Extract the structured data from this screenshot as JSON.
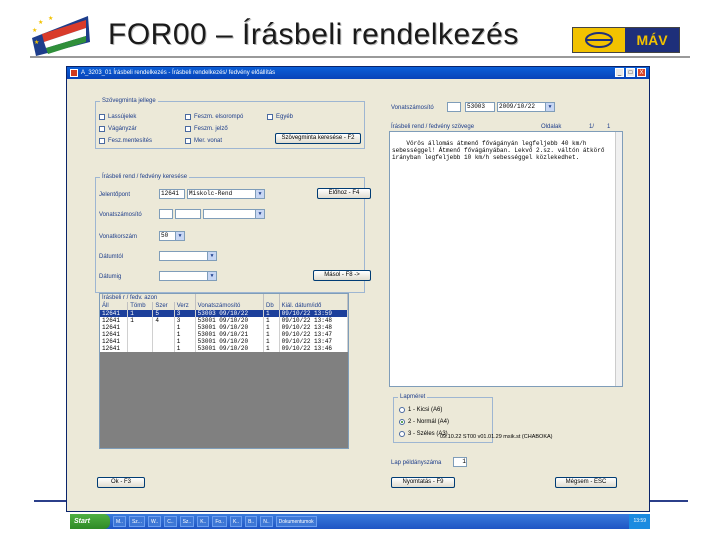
{
  "slide": {
    "title": "FOR00 – Írásbeli rendelkezés",
    "mav_logo_text": "MÁV"
  },
  "window": {
    "title": "A_3203_01  Írásbeli rendelkezés - Írásbeli rendelkezés/ fedvény előállítás",
    "buttons": [
      "_",
      "□",
      "X"
    ]
  },
  "doc_type": {
    "group_title": "Szövegminta jellege",
    "options": [
      "Lassújelek",
      "Vágányzár",
      "Fesz.mentesítés",
      "Feszm. elsorompó",
      "Feszm. jelző",
      "Mer. vonat",
      "Egyéb"
    ],
    "button": "Szövegminta keresése - F2"
  },
  "train": {
    "label": "Vonatszámosító",
    "number": "53003",
    "date": "2009/10/22"
  },
  "text_section": {
    "label": "Írásbeli rend / fedvény szövege",
    "pages_label": "Oldalak",
    "page": "1/",
    "total": "1",
    "body": "Vörös állomás átmenő fővágányán legfeljebb 40 km/h sebességgel! Átmenő fővágányában. Lekvő 2.sz. váltón átkörő irányban legfeljebb 10 km/h sebességgel közlekedhet."
  },
  "search": {
    "group_title": "Írásbeli rend / fedvény keresése",
    "location_label": "Jelentőpont",
    "location_code": "12641",
    "location_name": "Miskolc-Rend",
    "train_label": "Vonatszámosító",
    "hours_label": "Vonatkorszám",
    "hours_value": "50",
    "from_label": "Dátumtól",
    "to_label": "Dátumig",
    "fetch_button": "Előhoz - F4",
    "copy_button": "Másol - F8 ->"
  },
  "grid": {
    "title": "Írásbeli r / fedv. azon",
    "columns": [
      "Áll",
      "Tömb",
      "Szer",
      "Verz",
      "Vonatszámosító",
      "Db",
      "Kiál. dátum/idő"
    ],
    "rows": [
      [
        "12641",
        "1",
        "5",
        "3",
        "53003 09/10/22",
        "1",
        "09/10/22 13:59"
      ],
      [
        "12641",
        "1",
        "4",
        "3",
        "53001 09/10/20",
        "1",
        "09/10/22 13:48"
      ],
      [
        "12641",
        "",
        "",
        "1",
        "53001 09/10/20",
        "1",
        "09/10/22 13:48"
      ],
      [
        "12641",
        "",
        "",
        "1",
        "53001 09/10/21",
        "1",
        "09/10/22 13:47"
      ],
      [
        "12641",
        "",
        "",
        "1",
        "53001 09/10/20",
        "1",
        "09/10/22 13:47"
      ],
      [
        "12641",
        "",
        "",
        "1",
        "53001 09/10/20",
        "1",
        "09/10/22 13:46"
      ]
    ]
  },
  "paper": {
    "group_title": "Lapméret",
    "options": [
      "1 - Kicsi (A6)",
      "2 - Normál (A4)",
      "3 - Széles (A3)"
    ],
    "selected": 1
  },
  "copies": {
    "label": "Lap példányszáma",
    "value": "1"
  },
  "buttons": {
    "ok": "Ok - F3",
    "print": "Nyomtatás - F9",
    "cancel": "Mégsem - ESC"
  },
  "statusbar": "09.10.22 ST00 v01.01.29 msik.st (CHABOKA)",
  "taskbar": {
    "start": "Start",
    "items": [
      "M..",
      "Sz...",
      "W..",
      "C..",
      "Sz..",
      "K..",
      "Fo..",
      "K..",
      "B..",
      "N..",
      "Dokumentumok"
    ],
    "clock": "13:59"
  }
}
